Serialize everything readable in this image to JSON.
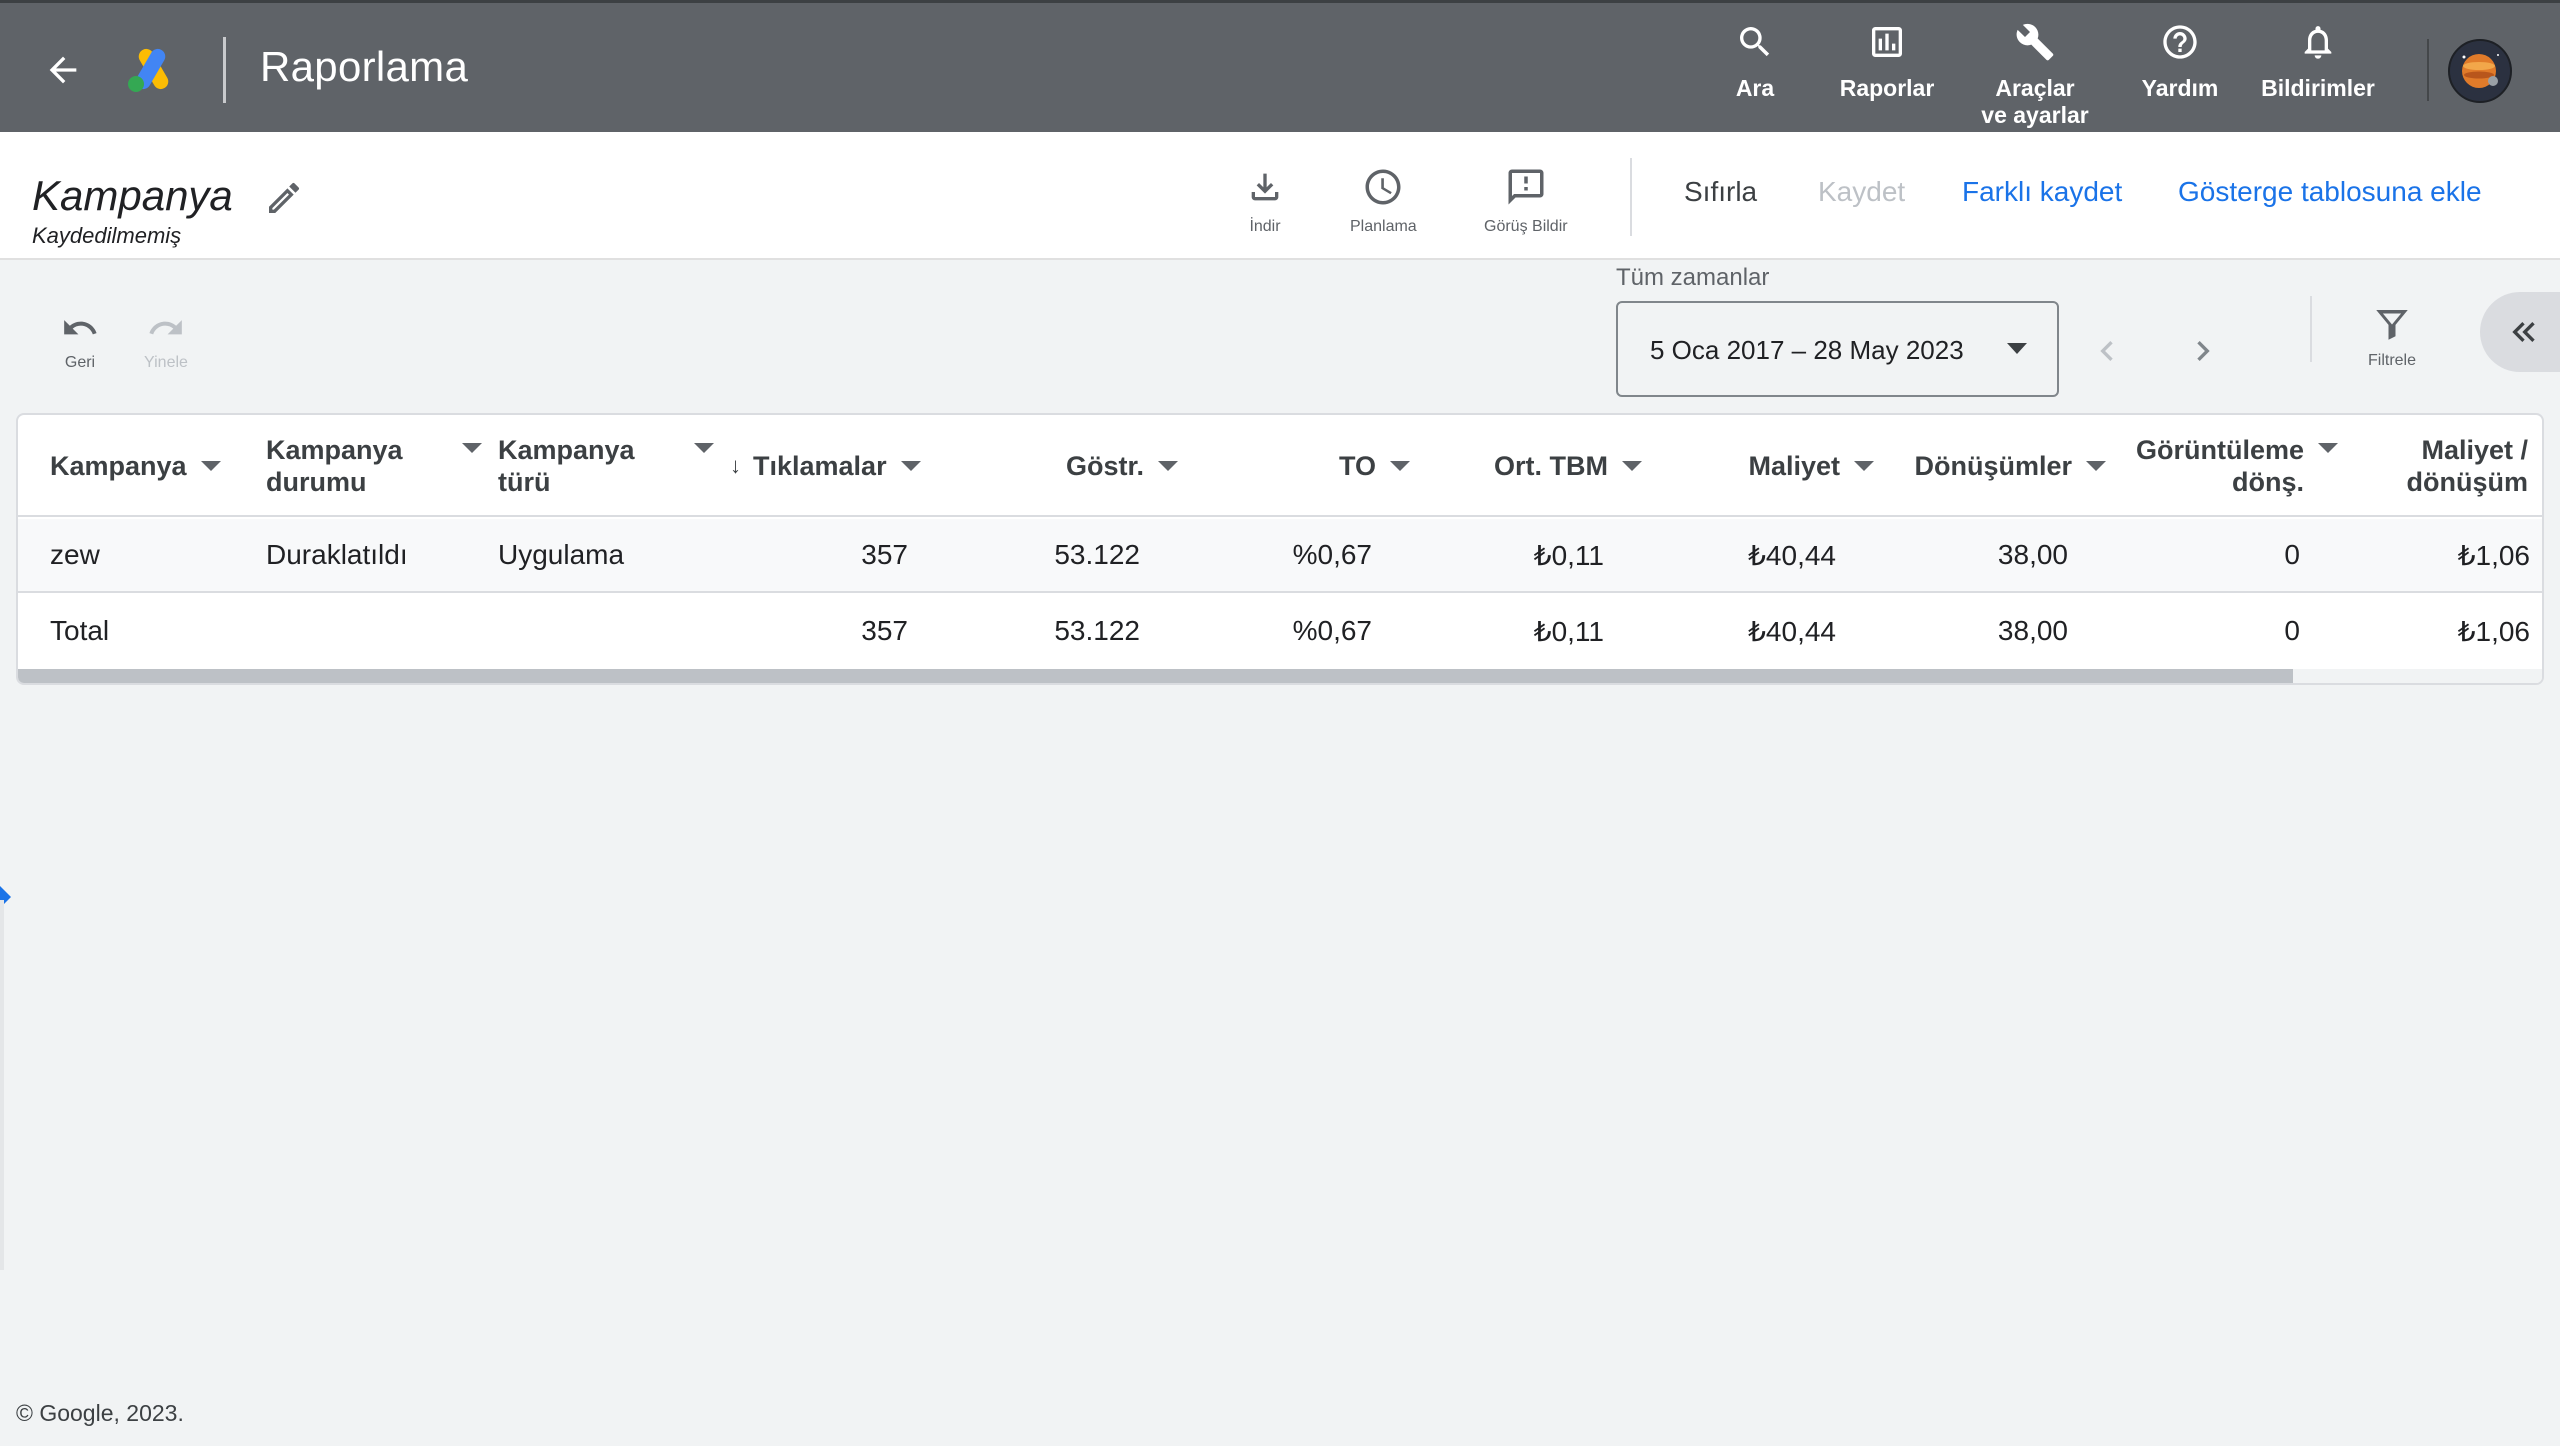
{
  "topbar": {
    "title": "Raporlama",
    "items": [
      {
        "label": "Ara",
        "icon": "search-icon"
      },
      {
        "label": "Raporlar",
        "icon": "reports-icon"
      },
      {
        "label": "Araçlar\nve ayarlar",
        "icon": "wrench-icon"
      },
      {
        "label": "Yardım",
        "icon": "help-icon"
      },
      {
        "label": "Bildirimler",
        "icon": "bell-icon"
      }
    ]
  },
  "report": {
    "title": "Kampanya",
    "subtitle": "Kaydedilmemiş",
    "tools": [
      {
        "label": "İndir",
        "icon": "download-icon"
      },
      {
        "label": "Planlama",
        "icon": "clock-icon"
      },
      {
        "label": "Görüş Bildir",
        "icon": "feedback-icon"
      }
    ],
    "actions": {
      "reset": "Sıfırla",
      "save": "Kaydet",
      "save_as": "Farklı kaydet",
      "add_dashboard": "Gösterge tablosuna ekle"
    }
  },
  "toolbar": {
    "undo": "Geri",
    "redo": "Yinele",
    "date_caption": "Tüm zamanlar",
    "date_range": "5 Oca 2017 – 28 May 2023",
    "filter": "Filtrele"
  },
  "table": {
    "columns": [
      "Kampanya",
      "Kampanya\ndurumu",
      "Kampanya\ntürü",
      "Tıklamalar",
      "Göstr.",
      "TO",
      "Ort. TBM",
      "Maliyet",
      "Dönüşümler",
      "Görüntüleme\ndönş.",
      "Maliyet /\ndönüşüm"
    ],
    "sort_indicator": "↓",
    "rows": [
      [
        "zew",
        "Duraklatıldı",
        "Uygulama",
        "357",
        "53.122",
        "%0,67",
        "₺0,11",
        "₺40,44",
        "38,00",
        "0",
        "₺1,06"
      ]
    ],
    "total": [
      "Total",
      "",
      "",
      "357",
      "53.122",
      "%0,67",
      "₺0,11",
      "₺40,44",
      "38,00",
      "0",
      "₺1,06"
    ],
    "scroll_position": 0.9
  },
  "footer": "© Google, 2023.",
  "colors": {
    "topbar": "#5f6368",
    "accent": "#1a73e8",
    "disabled": "#bdc1c6"
  }
}
